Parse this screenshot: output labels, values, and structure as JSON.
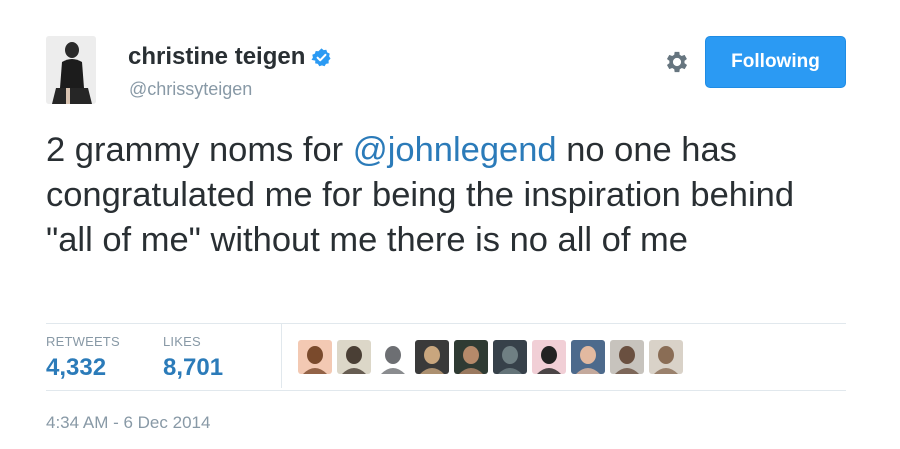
{
  "user": {
    "display_name": "christine teigen",
    "username": "@chrissyteigen",
    "verified_icon": "verified-badge-icon",
    "avatar_icon": "profile-photo"
  },
  "actions": {
    "settings_icon": "gear-icon",
    "follow_label": "Following",
    "follow_color": "#2b9af3"
  },
  "tweet": {
    "text_before": "2 grammy noms for ",
    "mention": "@johnlegend",
    "text_after": " no one has congratulated me for being the inspiration behind \"all of me\" without me there is no all of me"
  },
  "stats": {
    "retweets_label": "RETWEETS",
    "retweets_count": "4,332",
    "likes_label": "LIKES",
    "likes_count": "8,701"
  },
  "liker_avatars": [
    {
      "colors": [
        "#f3c9b3",
        "#7a4a2c"
      ]
    },
    {
      "colors": [
        "#dcd7c8",
        "#4a3f35"
      ]
    },
    {
      "colors": [
        "#ffffff",
        "#6d6f73"
      ]
    },
    {
      "colors": [
        "#3a3a3a",
        "#c9a67e"
      ]
    },
    {
      "colors": [
        "#2f3b33",
        "#b58a6a"
      ]
    },
    {
      "colors": [
        "#37414a",
        "#6f7f83"
      ]
    },
    {
      "colors": [
        "#f1cfd6",
        "#222222"
      ]
    },
    {
      "colors": [
        "#4d6a8c",
        "#e2b9a0"
      ]
    },
    {
      "colors": [
        "#c7c3bd",
        "#6a5040"
      ]
    },
    {
      "colors": [
        "#d9d2c8",
        "#8a6d55"
      ]
    }
  ],
  "timestamp": "4:34 AM - 6 Dec 2014",
  "colors": {
    "link": "#2b7bb9",
    "muted": "#8899a6",
    "text": "#292f33",
    "verified": "#2b9af3"
  }
}
